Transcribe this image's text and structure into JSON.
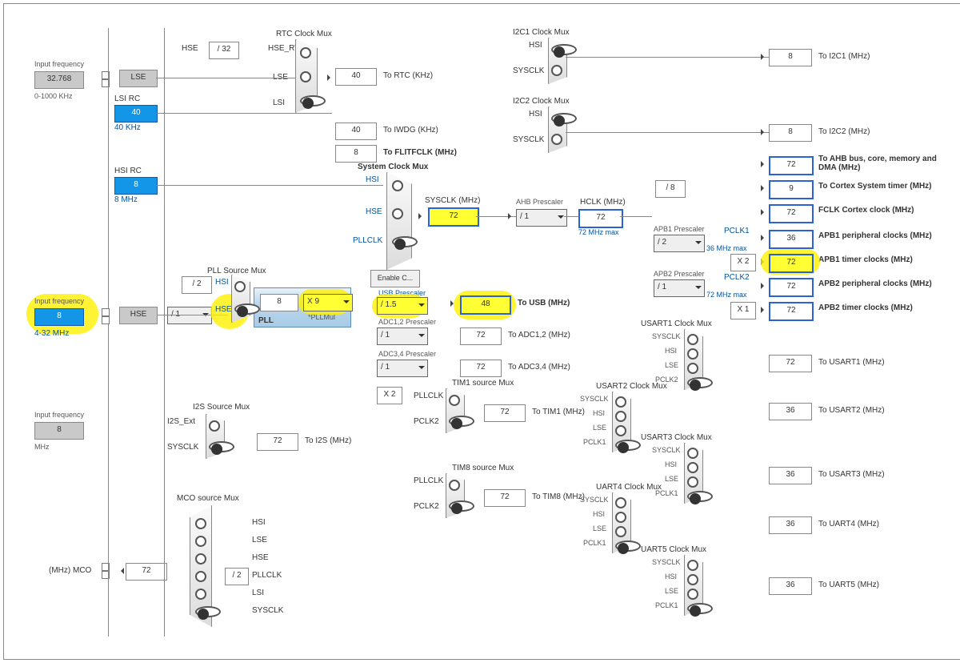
{
  "inputs": {
    "lse": {
      "label": "Input frequency",
      "value": "32.768",
      "range": "0-1000 KHz",
      "pin": "LSE"
    },
    "hse": {
      "label": "Input frequency",
      "value": "8",
      "range": "4-32 MHz",
      "pin": "HSE"
    },
    "i2s": {
      "label": "Input frequency",
      "value": "8",
      "range": "MHz"
    }
  },
  "osc": {
    "lsirc": {
      "name": "LSI RC",
      "value": "40",
      "note": "40 KHz"
    },
    "hsirc": {
      "name": "HSI RC",
      "value": "8",
      "note": "8 MHz"
    }
  },
  "rtc": {
    "title": "RTC Clock Mux",
    "hse_div": "/ 32",
    "hse_rtc": "HSE_RTC",
    "hse": "HSE",
    "lse": "LSE",
    "lsi": "LSI",
    "out": "40",
    "out_lbl": "To RTC (KHz)"
  },
  "iwdg": {
    "out": "40",
    "out_lbl": "To IWDG (KHz)"
  },
  "flit": {
    "out": "8",
    "out_lbl": "To FLITFCLK (MHz)"
  },
  "pll": {
    "src_title": "PLL Source Mux",
    "hsi": "HSI",
    "hsi_div": "/ 2",
    "hse": "HSE",
    "prediv": "/ 1",
    "pll_in": "8",
    "mul": "X 9",
    "mul_note": "*PLLMul",
    "block": "PLL"
  },
  "sysmux": {
    "title": "System Clock Mux",
    "hsi": "HSI",
    "hse": "HSE",
    "pllclk": "PLLCLK",
    "enable": "Enable C...",
    "sysclk_lbl": "SYSCLK (MHz)",
    "sysclk": "72"
  },
  "usb": {
    "title": "USB Prescaler",
    "div": "/ 1.5",
    "out": "48",
    "out_lbl": "To USB (MHz)"
  },
  "adc12": {
    "title": "ADC1,2 Prescaler",
    "div": "/ 1",
    "out": "72",
    "out_lbl": "To ADC1,2 (MHz)"
  },
  "adc34": {
    "title": "ADC3,4 Prescaler",
    "div": "/ 1",
    "out": "72",
    "out_lbl": "To ADC3,4 (MHz)"
  },
  "ahb": {
    "title": "AHB Prescaler",
    "div": "/ 1",
    "hclk_lbl": "HCLK (MHz)",
    "hclk": "72",
    "note": "72 MHz max",
    "div8": "/ 8"
  },
  "outs": {
    "ahb": {
      "val": "72",
      "lbl": "To AHB bus, core, memory and DMA (MHz)"
    },
    "systick": {
      "val": "9",
      "lbl": "To Cortex System timer (MHz)"
    },
    "fclk": {
      "val": "72",
      "lbl": "FCLK Cortex clock (MHz)"
    }
  },
  "apb1": {
    "title": "APB1 Prescaler",
    "div": "/ 2",
    "pclk": "PCLK1",
    "note": "36 MHz max",
    "periph": "36",
    "periph_lbl": "APB1 peripheral clocks (MHz)",
    "timmul": "X 2",
    "tim": "72",
    "tim_lbl": "APB1 timer clocks (MHz)"
  },
  "apb2": {
    "title": "APB2 Prescaler",
    "div": "/ 1",
    "pclk": "PCLK2",
    "note": "72 MHz max",
    "periph": "72",
    "periph_lbl": "APB2 peripheral clocks (MHz)",
    "timmul": "X 1",
    "tim": "72",
    "tim_lbl": "APB2 timer clocks (MHz)"
  },
  "i2c1": {
    "title": "I2C1 Clock Mux",
    "hsi": "HSI",
    "sysclk": "SYSCLK",
    "out": "8",
    "out_lbl": "To I2C1 (MHz)"
  },
  "i2c2": {
    "title": "I2C2 Clock Mux",
    "hsi": "HSI",
    "sysclk": "SYSCLK",
    "out": "8",
    "out_lbl": "To I2C2 (MHz)"
  },
  "tim1": {
    "title": "TIM1 source Mux",
    "x2": "X 2",
    "pllclk": "PLLCLK",
    "pclk2": "PCLK2",
    "out": "72",
    "out_lbl": "To TIM1 (MHz)"
  },
  "tim8": {
    "title": "TIM8 source Mux",
    "pllclk": "PLLCLK",
    "pclk2": "PCLK2",
    "out": "72",
    "out_lbl": "To TIM8 (MHz)"
  },
  "i2s": {
    "title": "I2S Source Mux",
    "ext": "I2S_Ext",
    "sysclk": "SYSCLK",
    "out": "72",
    "out_lbl": "To I2S (MHz)"
  },
  "mco": {
    "title": "MCO source Mux",
    "hsi": "HSI",
    "lse": "LSE",
    "hse": "HSE",
    "pllclk": "PLLCLK",
    "pll_div": "/ 2",
    "lsi": "LSI",
    "sysclk": "SYSCLK",
    "out": "72",
    "out_lbl": "(MHz) MCO"
  },
  "usart1": {
    "title": "USART1 Clock Mux",
    "sysclk": "SYSCLK",
    "hsi": "HSI",
    "lse": "LSE",
    "pclk": "PCLK2",
    "out": "72",
    "out_lbl": "To USART1 (MHz)"
  },
  "usart2": {
    "title": "USART2 Clock Mux",
    "sysclk": "SYSCLK",
    "hsi": "HSI",
    "lse": "LSE",
    "pclk": "PCLK1",
    "out": "36",
    "out_lbl": "To USART2 (MHz)"
  },
  "usart3": {
    "title": "USART3 Clock Mux",
    "sysclk": "SYSCLK",
    "hsi": "HSI",
    "lse": "LSE",
    "pclk": "PCLK1",
    "out": "36",
    "out_lbl": "To USART3 (MHz)"
  },
  "uart4": {
    "title": "UART4 Clock Mux",
    "sysclk": "SYSCLK",
    "hsi": "HSI",
    "lse": "LSE",
    "pclk": "PCLK1",
    "out": "36",
    "out_lbl": "To UART4 (MHz)"
  },
  "uart5": {
    "title": "UART5 Clock Mux",
    "sysclk": "SYSCLK",
    "hsi": "HSI",
    "lse": "LSE",
    "pclk": "PCLK1",
    "out": "36",
    "out_lbl": "To UART5 (MHz)"
  }
}
